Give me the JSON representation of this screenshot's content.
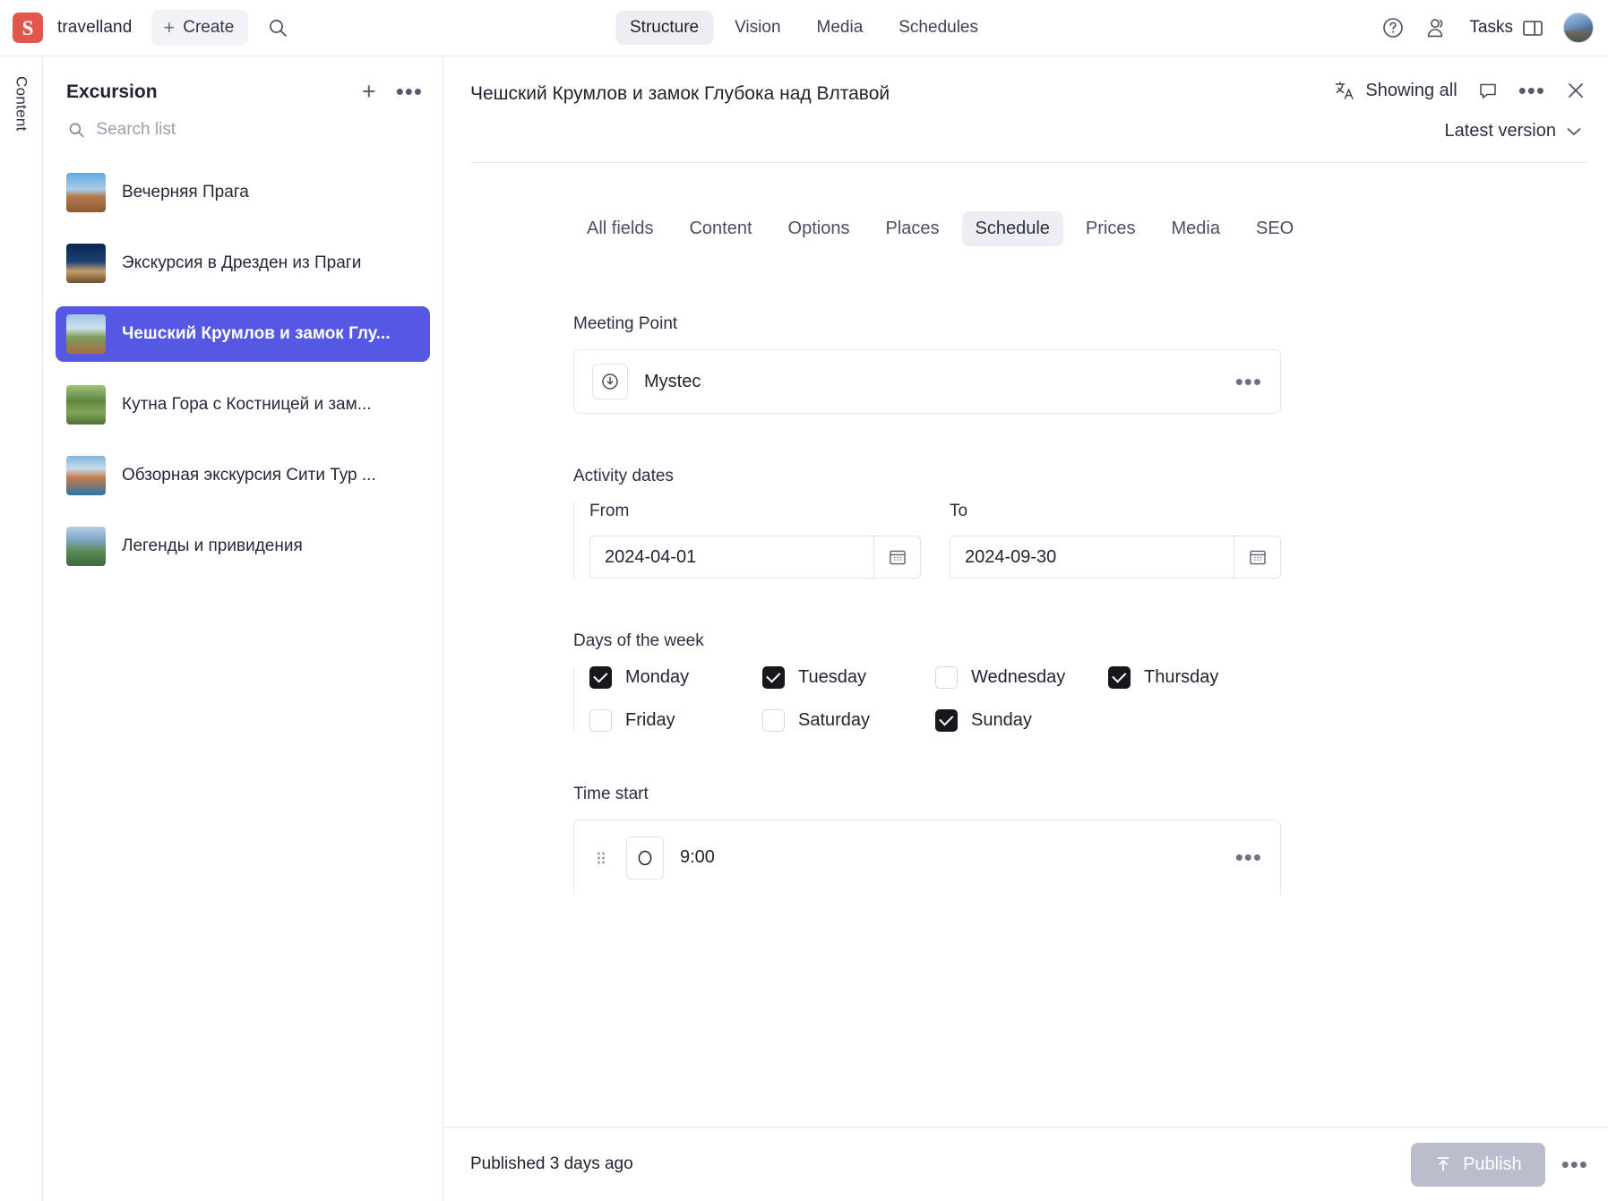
{
  "topbar": {
    "logo_letter": "S",
    "brand": "travelland",
    "create_label": "Create",
    "search_icon": "search-icon",
    "nav_tabs": [
      {
        "label": "Structure",
        "active": true
      },
      {
        "label": "Vision",
        "active": false
      },
      {
        "label": "Media",
        "active": false
      },
      {
        "label": "Schedules",
        "active": false
      }
    ],
    "help_icon": "question-circle-icon",
    "people_icon": "people-icon",
    "tasks_label": "Tasks",
    "panel_icon": "panel-layout-icon",
    "avatar": "user-avatar"
  },
  "rail": {
    "label": "Content"
  },
  "list_panel": {
    "title": "Excursion",
    "add_icon": "plus-icon",
    "more_icon": "ellipsis-icon",
    "search_placeholder": "Search list",
    "search_value": "",
    "items": [
      {
        "label": "Вечерняя Прага",
        "selected": false,
        "thumb": "t1"
      },
      {
        "label": "Экскурсия в Дрезден из Праги",
        "selected": false,
        "thumb": "t2"
      },
      {
        "label": "Чешский Крумлов и замок Глу...",
        "selected": true,
        "thumb": "t3"
      },
      {
        "label": "Кутна Гора с Костницей и зам...",
        "selected": false,
        "thumb": "t4"
      },
      {
        "label": "Обзорная экскурсия Сити Тур ...",
        "selected": false,
        "thumb": "t5"
      },
      {
        "label": "Легенды и привидения",
        "selected": false,
        "thumb": "t6"
      }
    ]
  },
  "main": {
    "doc_title": "Чешский Крумлов и замок Глубока над Влтавой",
    "translate_icon": "translate-icon",
    "showing_all_label": "Showing all",
    "comment_icon": "comment-icon",
    "more_icon": "ellipsis-icon",
    "close_icon": "close-icon",
    "version_label": "Latest version",
    "version_chevron": "chevron-down-icon",
    "field_tabs": [
      {
        "label": "All fields",
        "active": false
      },
      {
        "label": "Content",
        "active": false
      },
      {
        "label": "Options",
        "active": false
      },
      {
        "label": "Places",
        "active": false
      },
      {
        "label": "Schedule",
        "active": true
      },
      {
        "label": "Prices",
        "active": false
      },
      {
        "label": "Media",
        "active": false
      },
      {
        "label": "SEO",
        "active": false
      }
    ],
    "meeting_point": {
      "label": "Meeting Point",
      "icon": "clock-download-icon",
      "value": "Mystec",
      "row_more_icon": "ellipsis-icon"
    },
    "activity_dates": {
      "label": "Activity dates",
      "from_label": "From",
      "from_value": "2024-04-01",
      "to_label": "To",
      "to_value": "2024-09-30",
      "calendar_icon": "calendar-icon"
    },
    "days_of_week": {
      "label": "Days of the week",
      "days": [
        {
          "label": "Monday",
          "checked": true
        },
        {
          "label": "Tuesday",
          "checked": true
        },
        {
          "label": "Wednesday",
          "checked": false
        },
        {
          "label": "Thursday",
          "checked": true
        },
        {
          "label": "Friday",
          "checked": false
        },
        {
          "label": "Saturday",
          "checked": false
        },
        {
          "label": "Sunday",
          "checked": true
        }
      ]
    },
    "time_start": {
      "label": "Time start",
      "drag_icon": "drag-handle-icon",
      "item_icon": "clock-icon",
      "value": "9:00",
      "row_more_icon": "ellipsis-icon"
    }
  },
  "footer": {
    "status": "Published 3 days ago",
    "publish_label": "Publish",
    "publish_icon": "upload-icon",
    "more_icon": "ellipsis-icon"
  },
  "colors": {
    "logo_red": "#e2574c",
    "selection_blue": "#5558e3",
    "tab_active_bg": "#eceef2",
    "publish_disabled": "#b9bdcc",
    "border": "#e7e8ec"
  }
}
